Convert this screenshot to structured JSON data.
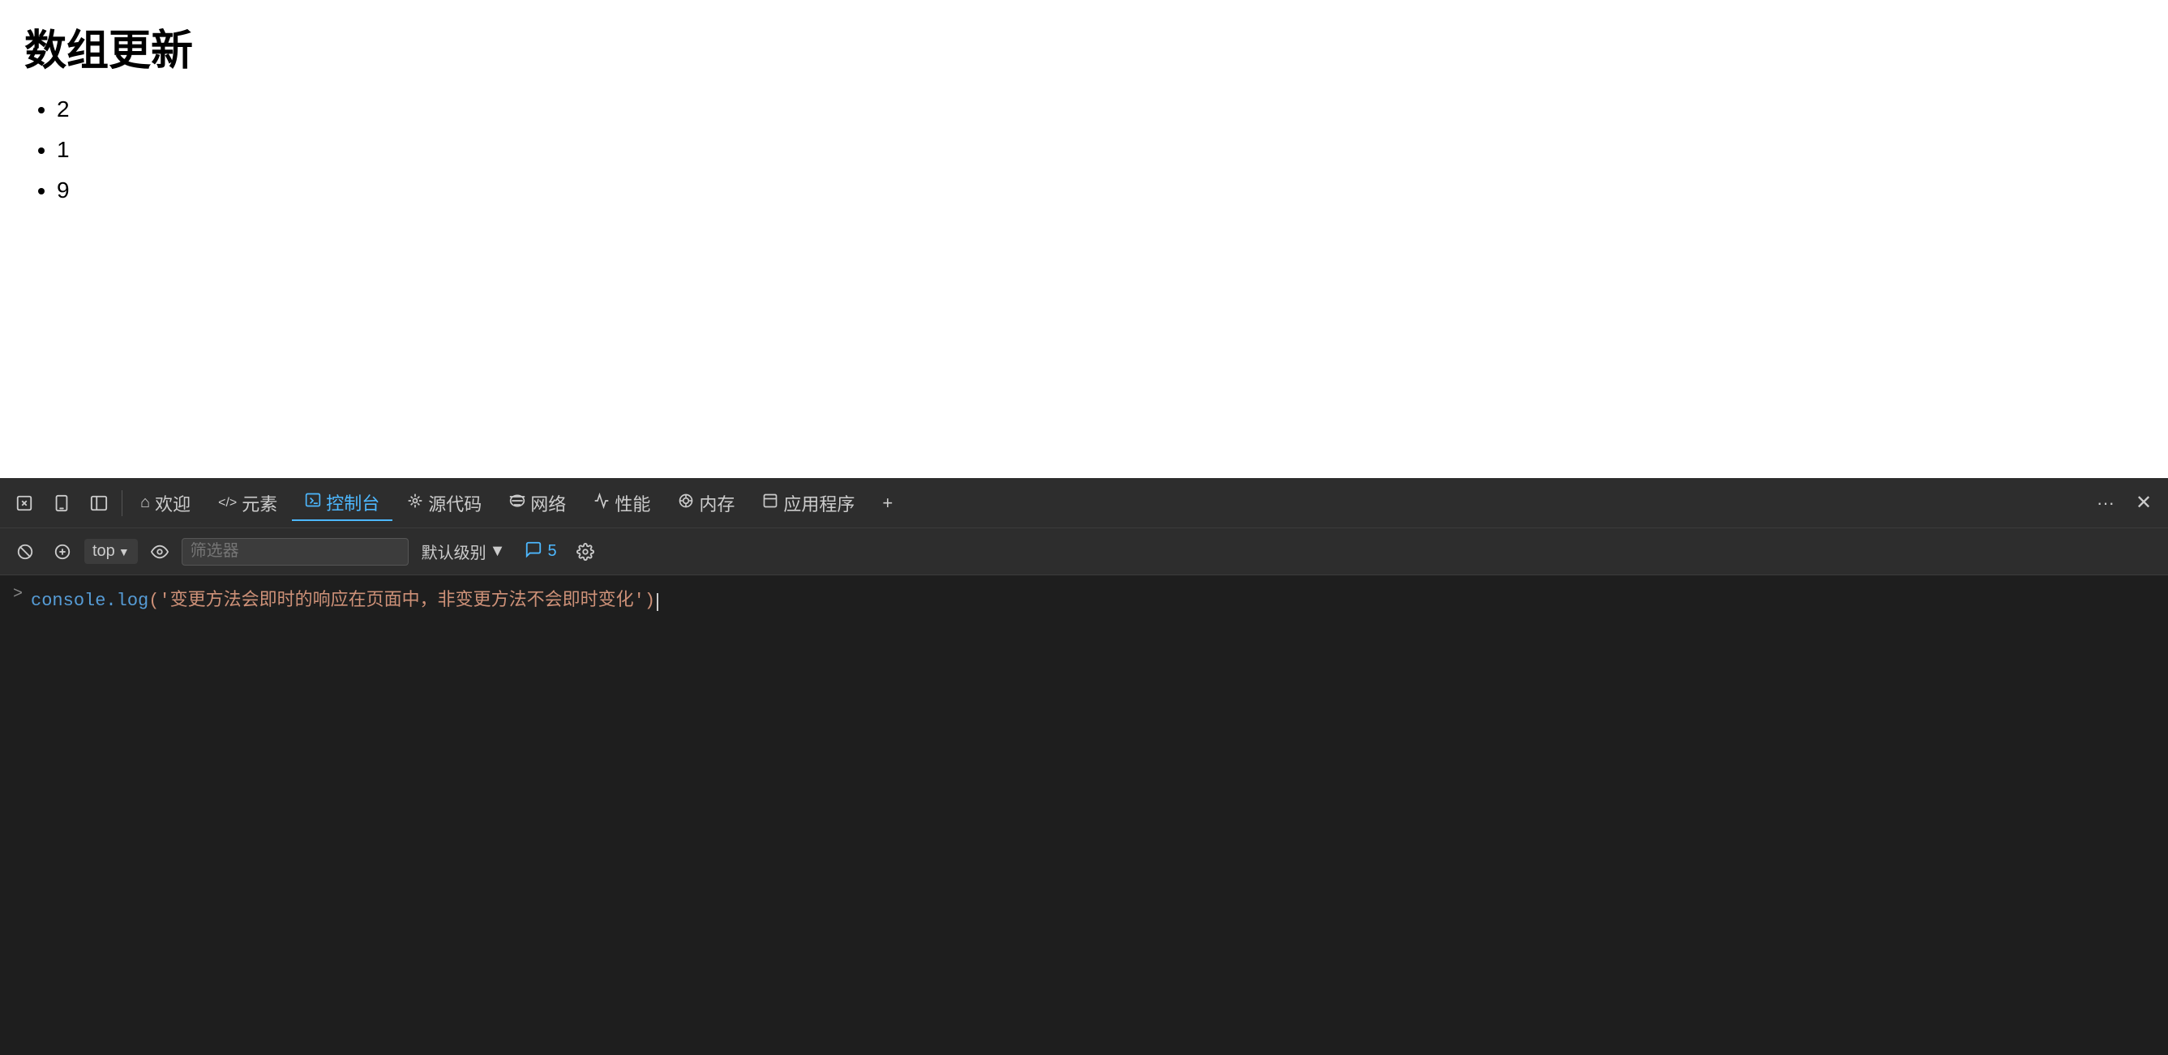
{
  "mainContent": {
    "title": "数组更新",
    "listItems": [
      "2",
      "1",
      "9"
    ]
  },
  "devtools": {
    "tabs": [
      {
        "id": "welcome",
        "label": "欢迎",
        "icon": "⌂"
      },
      {
        "id": "elements",
        "label": "元素",
        "icon": "</>"
      },
      {
        "id": "console",
        "label": "控制台",
        "icon": "▣",
        "active": true
      },
      {
        "id": "sources",
        "label": "源代码",
        "icon": "✦"
      },
      {
        "id": "network",
        "label": "网络",
        "icon": "((()))"
      },
      {
        "id": "performance",
        "label": "性能",
        "icon": "~"
      },
      {
        "id": "memory",
        "label": "内存",
        "icon": "⊙"
      },
      {
        "id": "application",
        "label": "应用程序",
        "icon": "⬜"
      }
    ],
    "moreLabel": "···",
    "consoleToolbar": {
      "clearLabel": "🚫",
      "contextValue": "top",
      "eyeLabel": "👁",
      "filterPlaceholder": "筛选器",
      "levelLabel": "默认级别",
      "issuesCount": "5",
      "settingsLabel": "⚙"
    },
    "consoleLine": {
      "arrow": ">",
      "method": "console.log",
      "content": "('变更方法会即时的响应在页面中，非变更方法不会即时变化')"
    }
  }
}
